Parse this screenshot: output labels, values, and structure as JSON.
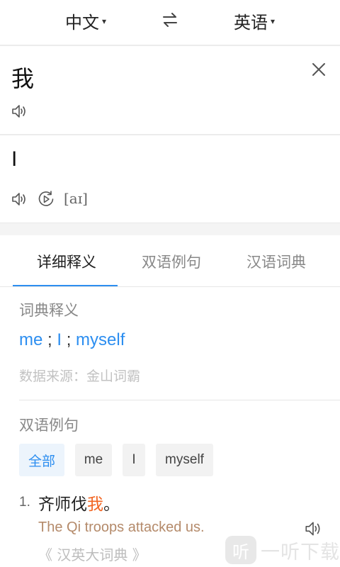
{
  "lang_bar": {
    "source_lang": "中文",
    "target_lang": "英语",
    "caret": "▾"
  },
  "input": {
    "text": "我"
  },
  "result": {
    "text": "I",
    "phonetic": "[aɪ]"
  },
  "tabs": [
    {
      "label": "详细释义",
      "active": true
    },
    {
      "label": "双语例句",
      "active": false
    },
    {
      "label": "汉语词典",
      "active": false
    }
  ],
  "dictionary": {
    "title": "词典释义",
    "meanings": [
      "me",
      "I",
      "myself"
    ],
    "separator": ";",
    "source": "数据来源：金山词霸"
  },
  "bilingual": {
    "title": "双语例句",
    "filters": [
      "全部",
      "me",
      "I",
      "myself"
    ],
    "examples": [
      {
        "index": "1.",
        "cn_before": "齐师伐",
        "cn_highlight": "我",
        "cn_after": "。",
        "en": "The Qi troops attacked us.",
        "source": "《 汉英大词典 》"
      }
    ]
  },
  "watermark": {
    "badge": "听",
    "text": "一听下载"
  },
  "colors": {
    "accent": "#2c8ef0",
    "highlight": "#f26522"
  },
  "icons": {
    "swap": "swap-arrows-icon",
    "close": "close-icon",
    "speaker": "speaker-icon",
    "replay": "replay-icon"
  }
}
